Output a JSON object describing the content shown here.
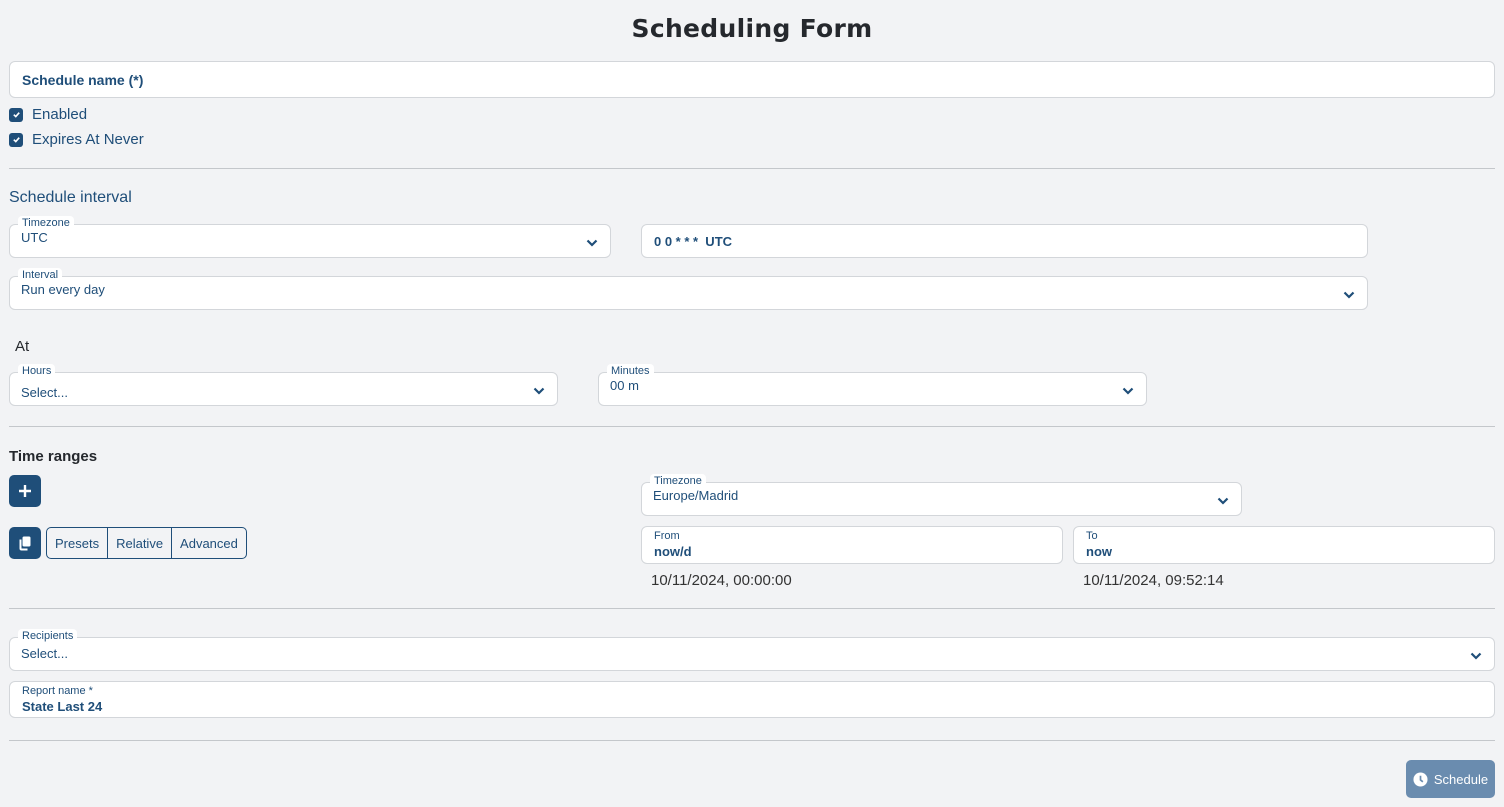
{
  "page": {
    "title": "Scheduling Form"
  },
  "schedule_name": {
    "placeholder": "Schedule name (*)",
    "value": ""
  },
  "checkboxes": [
    {
      "label": "Enabled",
      "checked": true
    },
    {
      "label": "Expires At Never",
      "checked": true
    }
  ],
  "schedule_interval": {
    "heading": "Schedule interval",
    "timezone": {
      "label": "Timezone",
      "value": "UTC"
    },
    "cron_expression": "0 0 * * *  UTC",
    "interval": {
      "label": "Interval",
      "value": "Run every day"
    },
    "at_label": "At",
    "hours": {
      "label": "Hours",
      "value": "Select..."
    },
    "minutes": {
      "label": "Minutes",
      "value": "00 m"
    }
  },
  "time_ranges": {
    "heading": "Time ranges",
    "add_icon": "plus-icon",
    "copy_icon": "copy-icon",
    "segments": [
      "Presets",
      "Relative",
      "Advanced"
    ],
    "timezone": {
      "label": "Timezone",
      "value": "Europe/Madrid"
    },
    "from": {
      "label": "From",
      "value": "now/d",
      "resolved": "10/11/2024, 00:00:00"
    },
    "to": {
      "label": "To",
      "value": "now",
      "resolved": "10/11/2024, 09:52:14"
    }
  },
  "recipients": {
    "label": "Recipients",
    "value": "Select..."
  },
  "report_name": {
    "label": "Report name *",
    "value": "State Last 24"
  },
  "actions": {
    "schedule_label": "Schedule",
    "schedule_icon": "clock-icon"
  },
  "colors": {
    "primary": "#1f4e79",
    "background": "#f2f3f5",
    "button_disabled": "#6a8caf",
    "border": "#d3d6da"
  }
}
